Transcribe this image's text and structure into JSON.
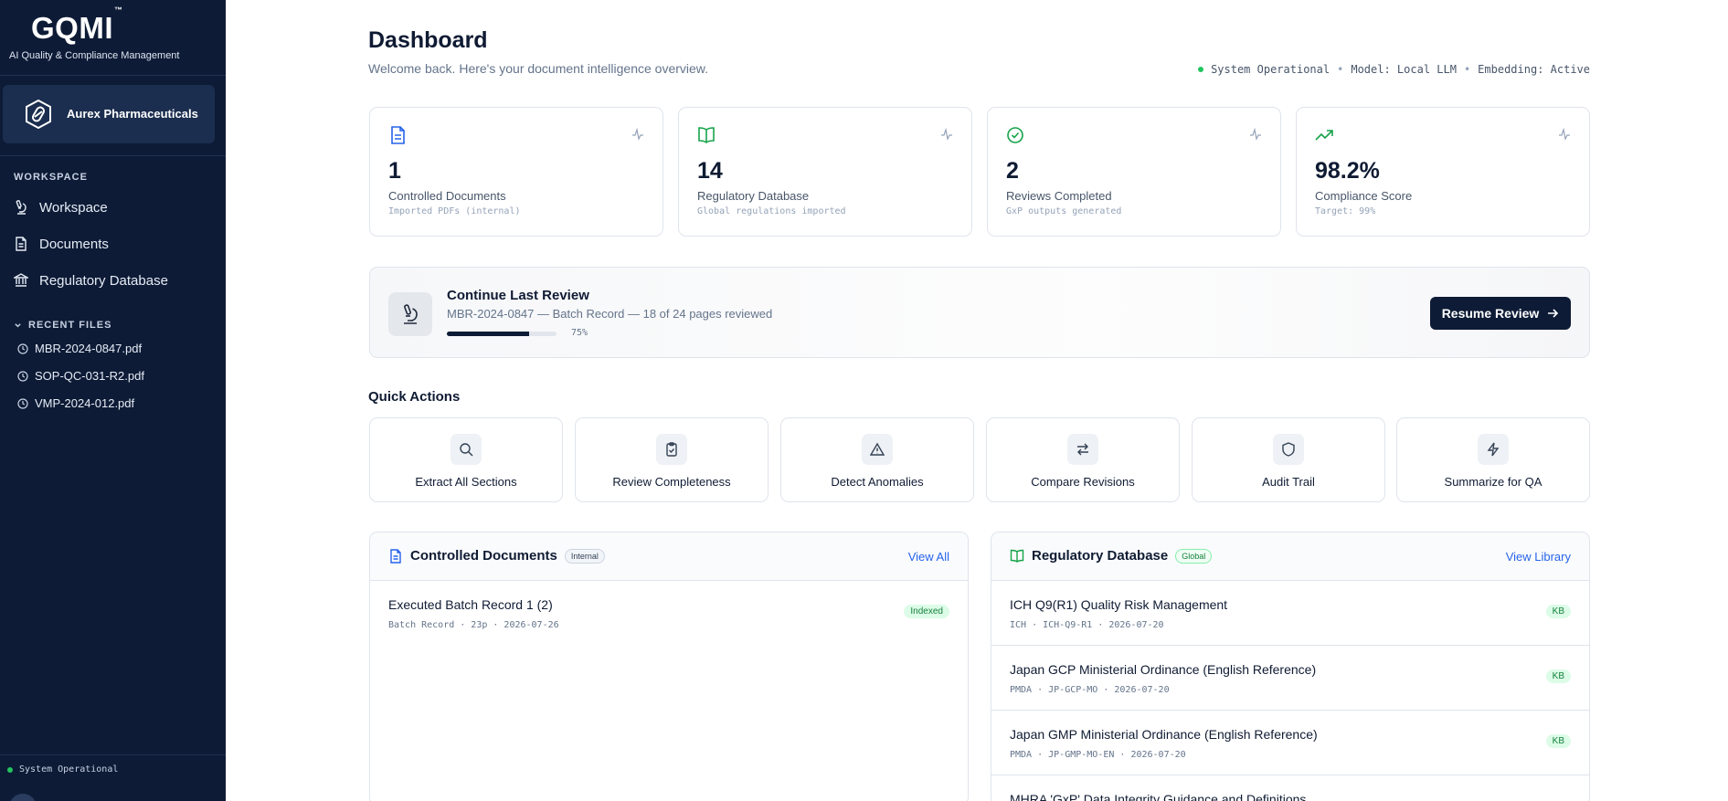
{
  "brand": {
    "logo": "GQMI",
    "tm": "™",
    "tagline": "AI Quality & Compliance Management",
    "org": "Aurex Pharmaceuticals"
  },
  "sidebar": {
    "workspace_heading": "WORKSPACE",
    "nav": [
      {
        "label": "Workspace",
        "icon": "microscope-icon"
      },
      {
        "label": "Documents",
        "icon": "document-icon"
      },
      {
        "label": "Regulatory Database",
        "icon": "bank-icon"
      }
    ],
    "recent_heading": "RECENT FILES",
    "recent": [
      "MBR-2024-0847.pdf",
      "SOP-QC-031-R2.pdf",
      "VMP-2024-012.pdf"
    ],
    "status": "System Operational"
  },
  "header": {
    "title": "Dashboard",
    "subtitle": "Welcome back. Here's your document intelligence overview.",
    "system": "System Operational",
    "model": "Model: Local LLM",
    "embedding": "Embedding: Active",
    "sep": "•"
  },
  "stats": [
    {
      "value": "1",
      "label": "Controlled Documents",
      "sub": "Imported PDFs (internal)",
      "icon": "document-icon",
      "color": "#2563eb"
    },
    {
      "value": "14",
      "label": "Regulatory Database",
      "sub": "Global regulations imported",
      "icon": "book-icon",
      "color": "#16a34a"
    },
    {
      "value": "2",
      "label": "Reviews Completed",
      "sub": "GxP outputs generated",
      "icon": "check-circle-icon",
      "color": "#16a34a"
    },
    {
      "value": "98.2%",
      "label": "Compliance Score",
      "sub": "Target: 99%",
      "icon": "trending-up-icon",
      "color": "#16a34a"
    }
  ],
  "resume": {
    "title": "Continue Last Review",
    "subtitle": "MBR-2024-0847 — Batch Record — 18 of 24 pages reviewed",
    "progress": 0.75,
    "progress_label": "75%",
    "button": "Resume Review"
  },
  "quick_actions": {
    "title": "Quick Actions",
    "items": [
      {
        "label": "Extract All Sections",
        "icon": "search-icon"
      },
      {
        "label": "Review Completeness",
        "icon": "clipboard-check-icon"
      },
      {
        "label": "Detect Anomalies",
        "icon": "warning-icon"
      },
      {
        "label": "Compare Revisions",
        "icon": "swap-icon"
      },
      {
        "label": "Audit Trail",
        "icon": "shield-icon"
      },
      {
        "label": "Summarize for QA",
        "icon": "lightning-icon"
      }
    ]
  },
  "controlled_docs": {
    "title": "Controlled Documents",
    "badge": "Internal",
    "link": "View All",
    "rows": [
      {
        "name": "Executed Batch Record 1 (2)",
        "meta": "Batch Record  ·  23p  ·  2026-07-26",
        "tag": "Indexed"
      }
    ]
  },
  "reg_db": {
    "title": "Regulatory Database",
    "badge": "Global",
    "link": "View Library",
    "rows": [
      {
        "name": "ICH Q9(R1) Quality Risk Management",
        "meta": "ICH  ·  ICH-Q9-R1  ·  2026-07-20",
        "tag": "KB"
      },
      {
        "name": "Japan GCP Ministerial Ordinance (English Reference)",
        "meta": "PMDA  ·  JP-GCP-MO  ·  2026-07-20",
        "tag": "KB"
      },
      {
        "name": "Japan GMP Ministerial Ordinance (English Reference)",
        "meta": "PMDA  ·  JP-GMP-MO-EN  ·  2026-07-20",
        "tag": "KB"
      },
      {
        "name": "MHRA 'GxP' Data Integrity Guidance and Definitions",
        "meta": "",
        "tag": ""
      }
    ]
  }
}
